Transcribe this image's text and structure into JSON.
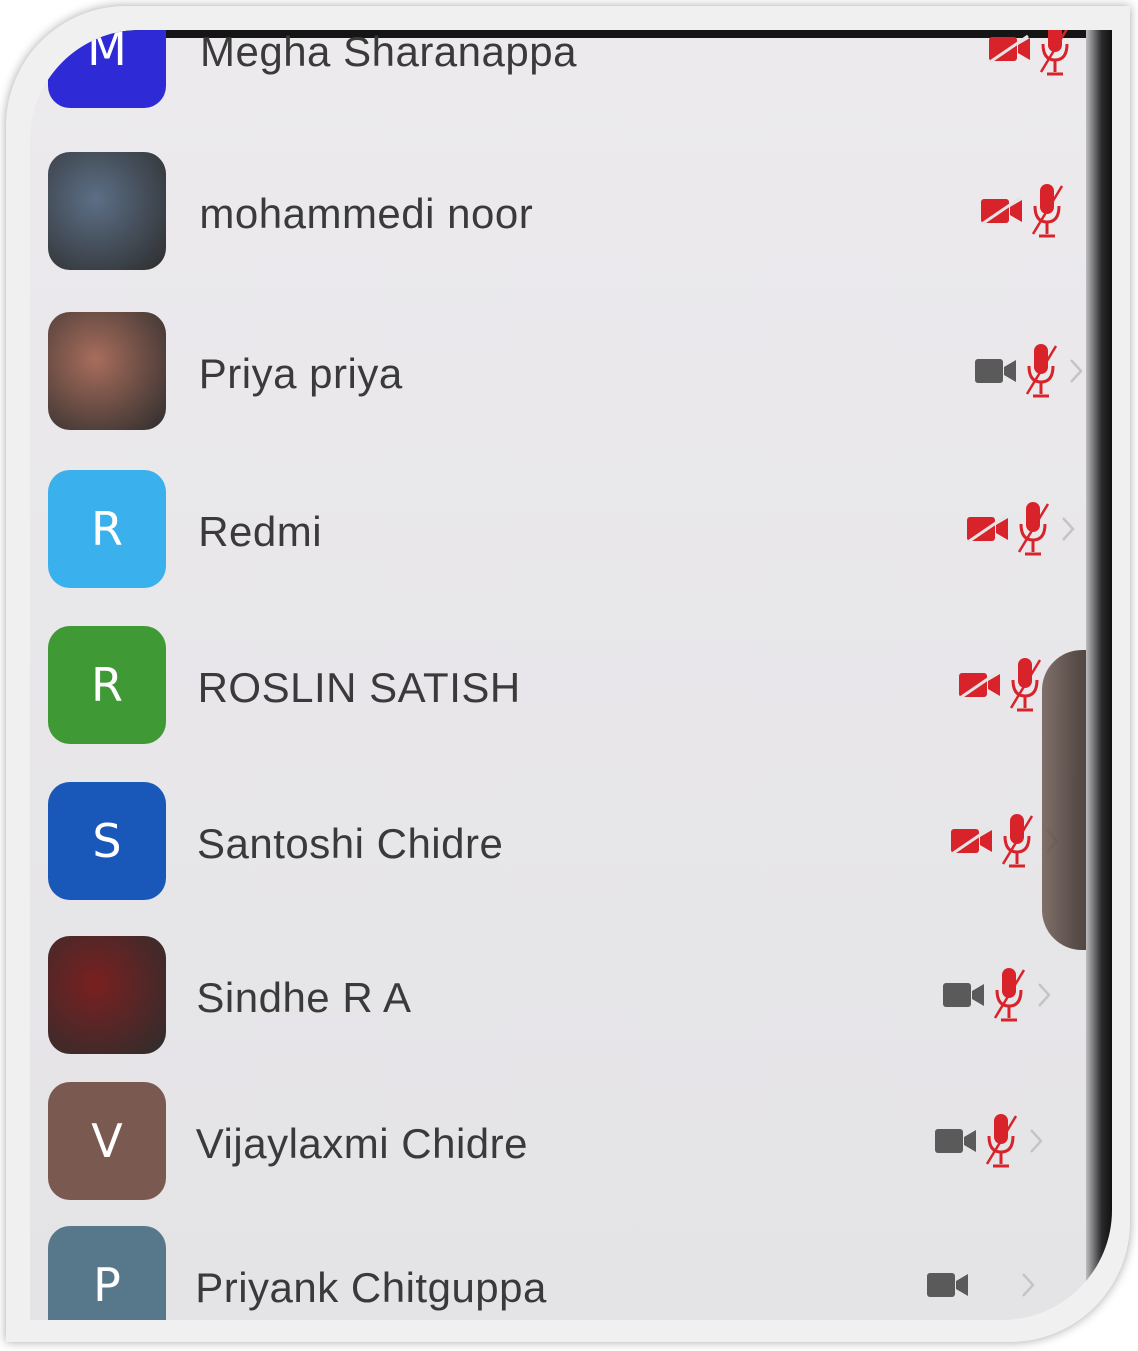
{
  "participants": [
    {
      "name": "Megha Sharanappa",
      "avatar_letter": "M",
      "avatar_color": "#2e2ad6",
      "video": "off",
      "audio": "muted",
      "chevron": false
    },
    {
      "name": "mohammedi noor",
      "avatar_letter": "",
      "avatar_color": "#5c6f86",
      "video": "off",
      "audio": "muted",
      "chevron": false
    },
    {
      "name": "Priya priya",
      "avatar_letter": "",
      "avatar_color": "#a86d5c",
      "video": "on",
      "audio": "muted",
      "chevron": true
    },
    {
      "name": "Redmi",
      "avatar_letter": "R",
      "avatar_color": "#3ab0ec",
      "video": "off",
      "audio": "muted",
      "chevron": true
    },
    {
      "name": "ROSLIN SATISH",
      "avatar_letter": "R",
      "avatar_color": "#3f9a36",
      "video": "off",
      "audio": "muted",
      "chevron": false
    },
    {
      "name": "Santoshi Chidre",
      "avatar_letter": "S",
      "avatar_color": "#1958b8",
      "video": "off",
      "audio": "muted",
      "chevron": true
    },
    {
      "name": "Sindhe R A",
      "avatar_letter": "",
      "avatar_color": "#7a2020",
      "video": "on",
      "audio": "muted",
      "chevron": true
    },
    {
      "name": "Vijaylaxmi Chidre",
      "avatar_letter": "V",
      "avatar_color": "#7a5a50",
      "video": "on",
      "audio": "muted",
      "chevron": true
    },
    {
      "name": "Priyank Chitguppa",
      "avatar_letter": "P",
      "avatar_color": "#56788a",
      "video": "on",
      "audio": "none",
      "chevron": true
    }
  ],
  "colors": {
    "muted_red": "#d8232a",
    "video_on_gray": "#5a5a5a",
    "name_text": "#3a3a3a"
  },
  "icons": [
    "video-camera-icon",
    "microphone-muted-icon",
    "chevron-right-icon"
  ]
}
